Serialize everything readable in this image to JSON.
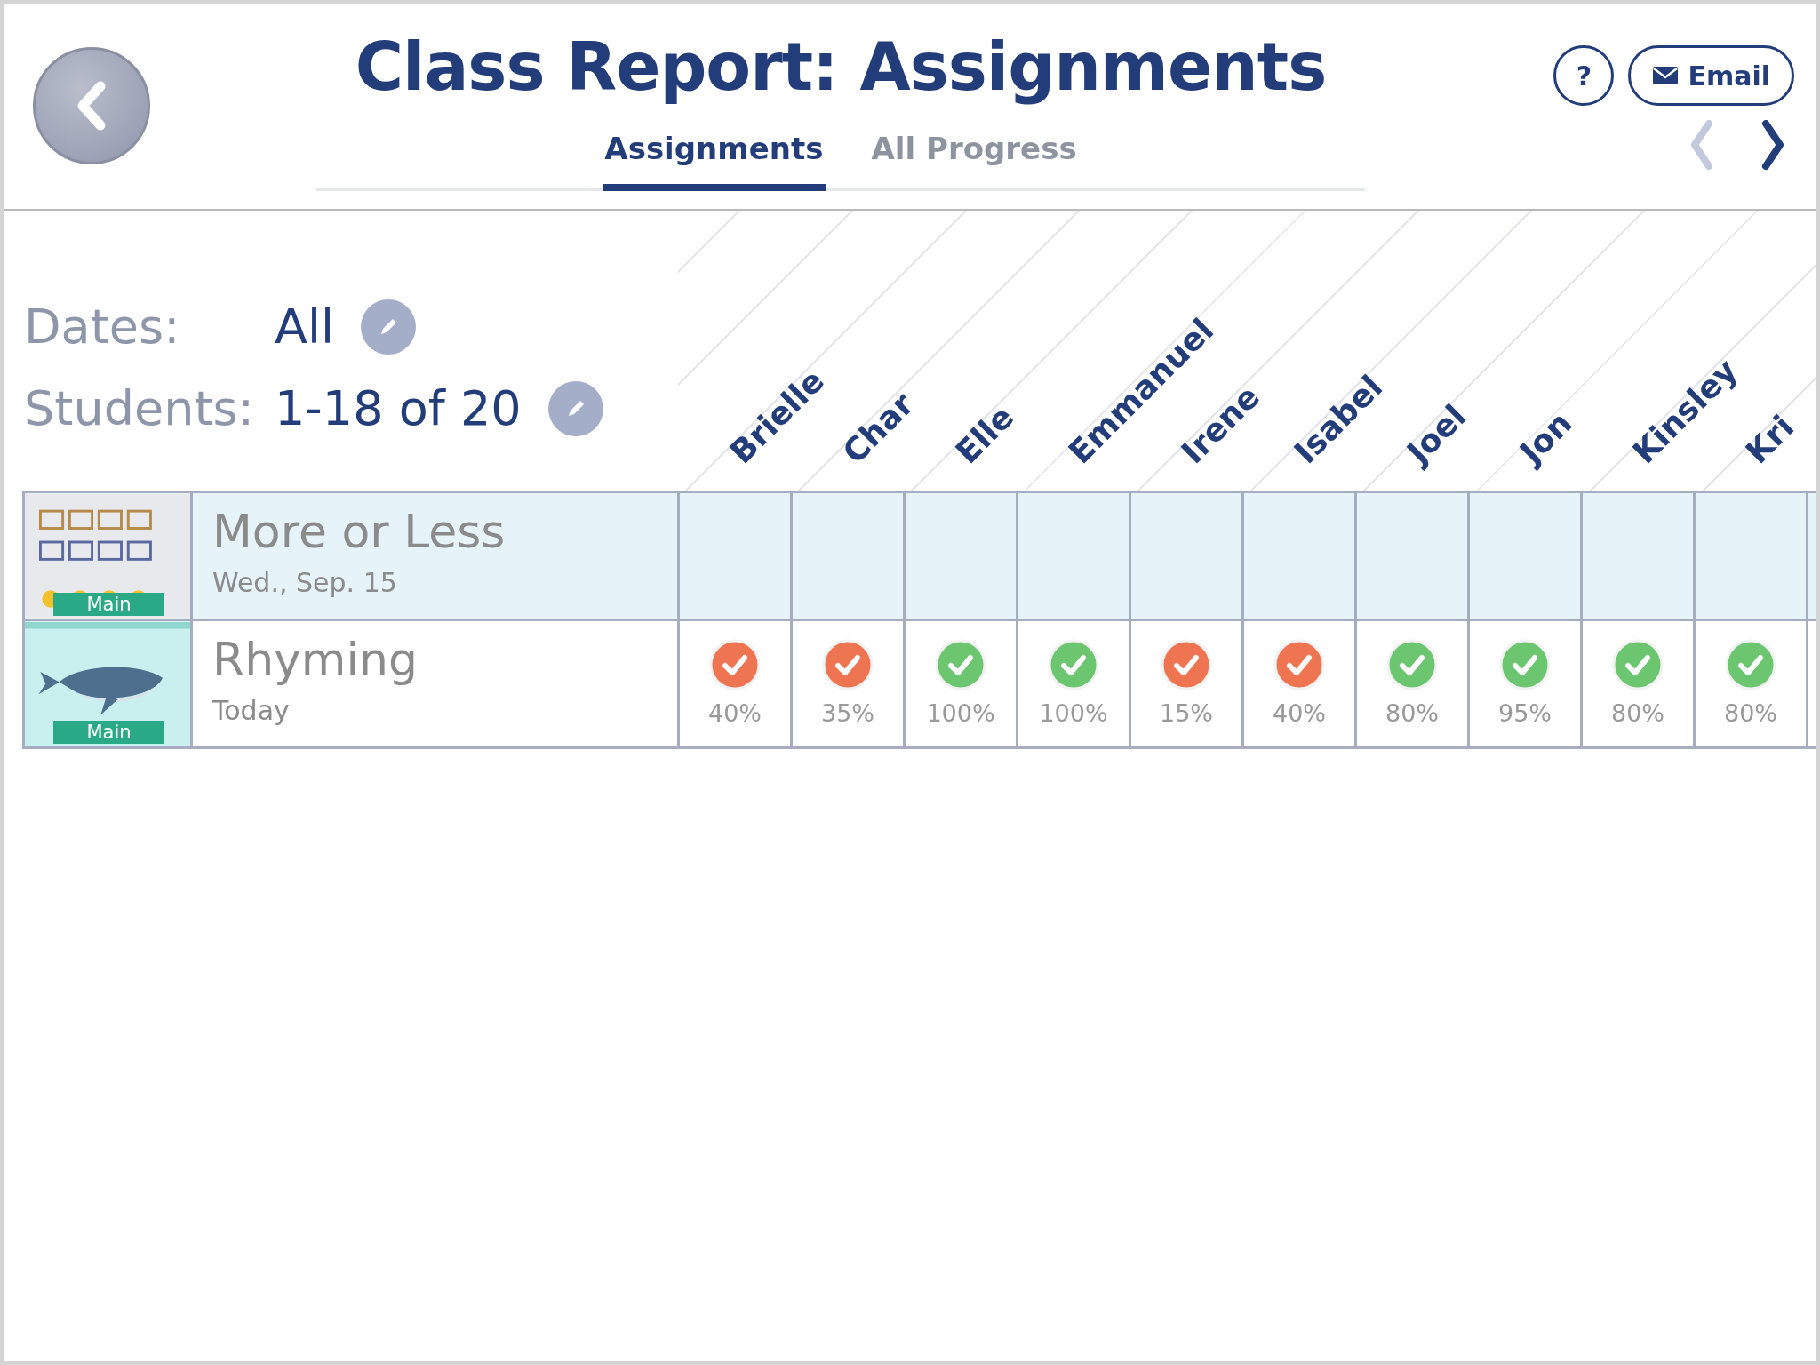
{
  "header": {
    "title": "Class Report: Assignments",
    "help_label": "?",
    "email_label": "Email",
    "prev_disabled": true,
    "next_disabled": false
  },
  "tabs": [
    {
      "label": "Assignments",
      "selected": true
    },
    {
      "label": "All Progress",
      "selected": false
    }
  ],
  "filters": [
    {
      "label": "Dates:",
      "value": "All"
    },
    {
      "label": "Students:",
      "value": "1-18 of 20"
    }
  ],
  "students": [
    "Brielle",
    "Char",
    "Elle",
    "Emmanuel",
    "Irene",
    "Isabel",
    "Joel",
    "Jon",
    "Kinsley",
    "Kri"
  ],
  "assignments": [
    {
      "name": "More or Less",
      "date": "Wed., Sep. 15",
      "tag": "Main",
      "kind": "boxes",
      "selected": true
    },
    {
      "name": "Rhyming",
      "date": "Today",
      "tag": "Main",
      "kind": "whale",
      "selected": false,
      "results": [
        {
          "passed": false,
          "score": "40%"
        },
        {
          "passed": false,
          "score": "35%"
        },
        {
          "passed": true,
          "score": "100%"
        },
        {
          "passed": true,
          "score": "100%"
        },
        {
          "passed": false,
          "score": "15%"
        },
        {
          "passed": false,
          "score": "40%"
        },
        {
          "passed": true,
          "score": "80%"
        },
        {
          "passed": true,
          "score": "95%"
        },
        {
          "passed": true,
          "score": "80%"
        },
        {
          "passed": true,
          "score": "80%"
        }
      ]
    }
  ]
}
